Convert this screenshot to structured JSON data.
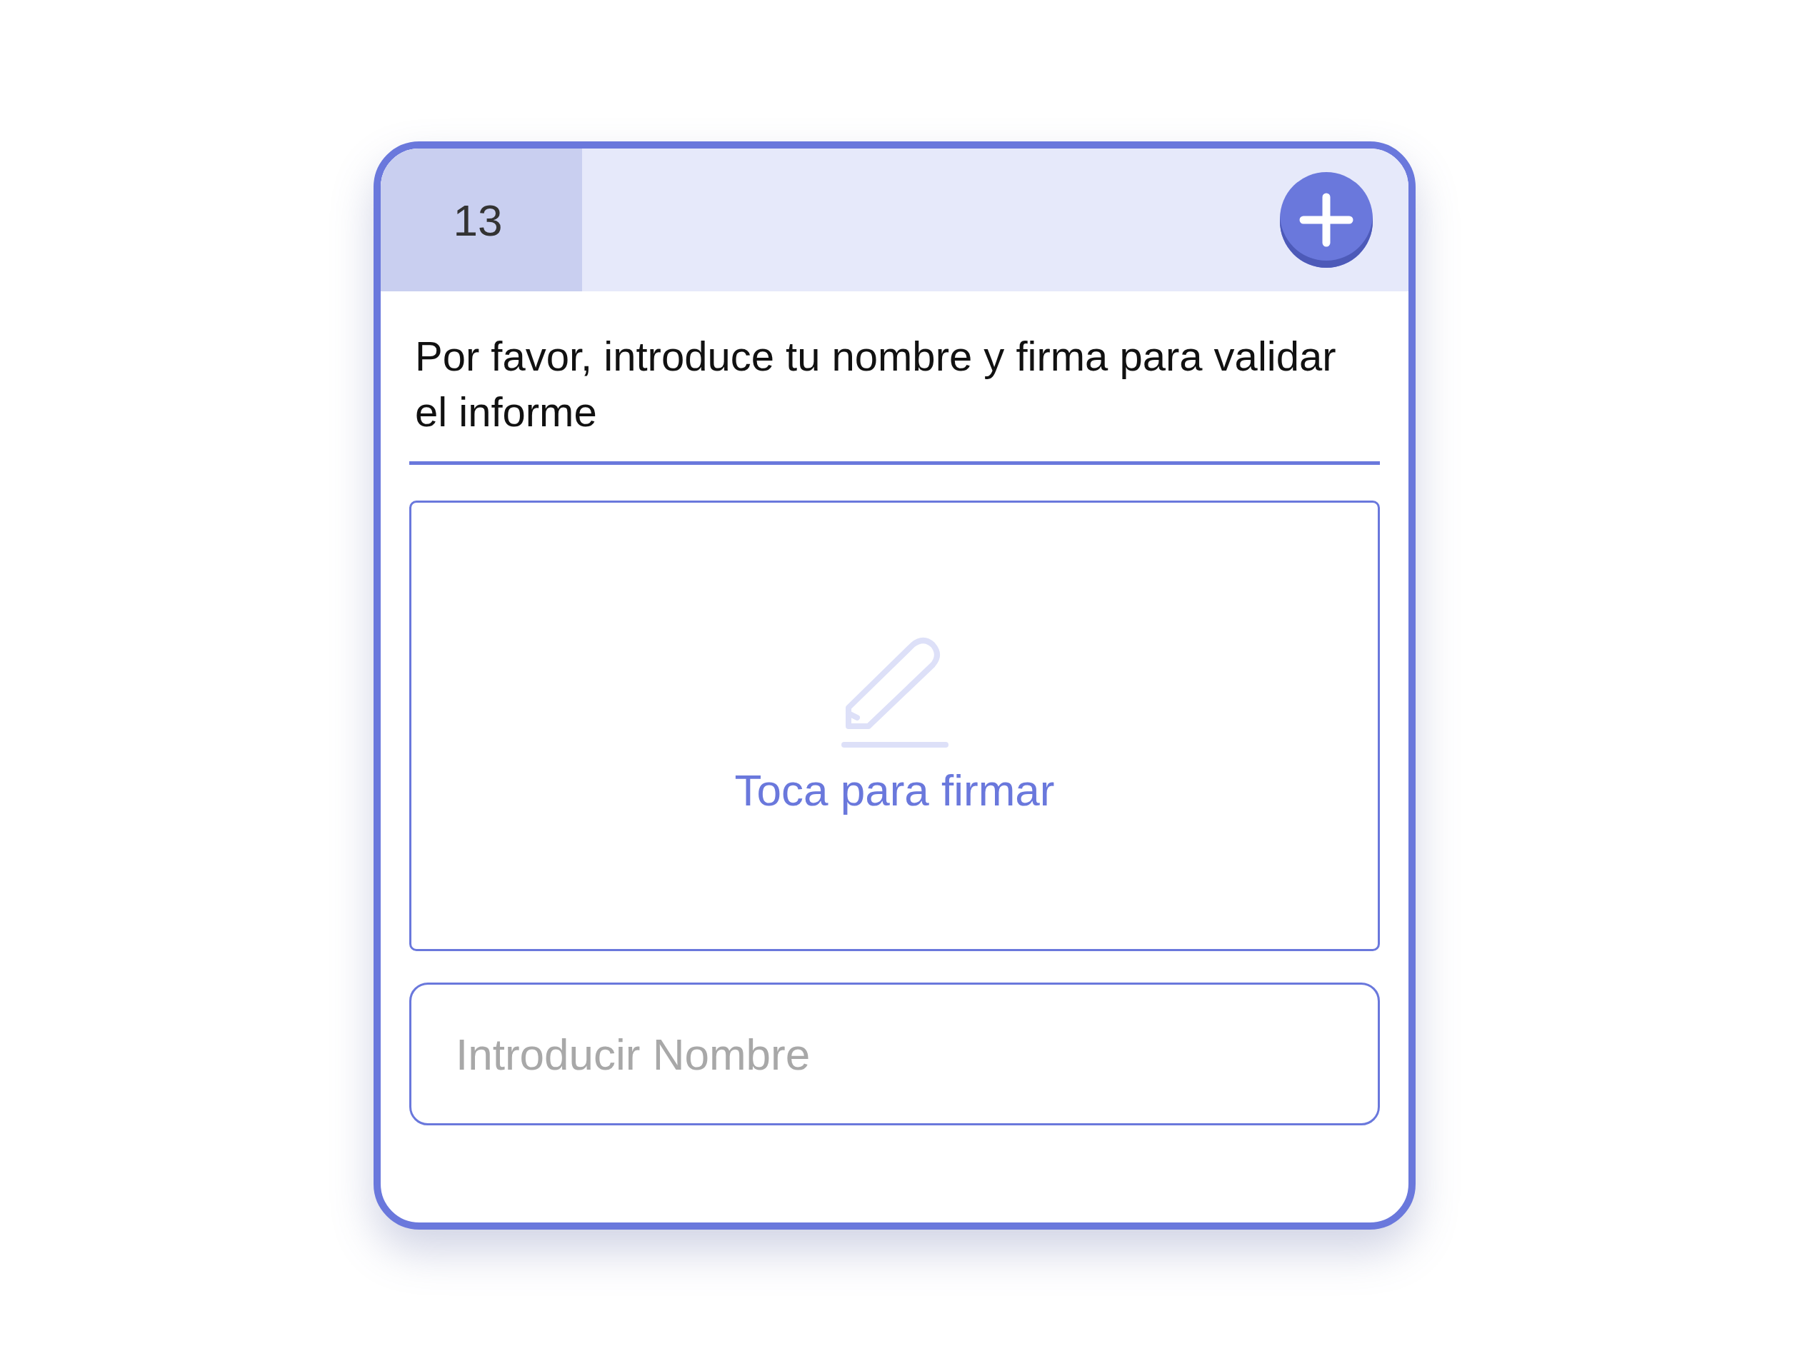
{
  "card": {
    "number": "13",
    "question": "Por favor, introduce tu nombre y firma para validar el informe",
    "signature": {
      "prompt": "Toca para firmar"
    },
    "name_field": {
      "placeholder": "Introducir Nombre"
    }
  }
}
